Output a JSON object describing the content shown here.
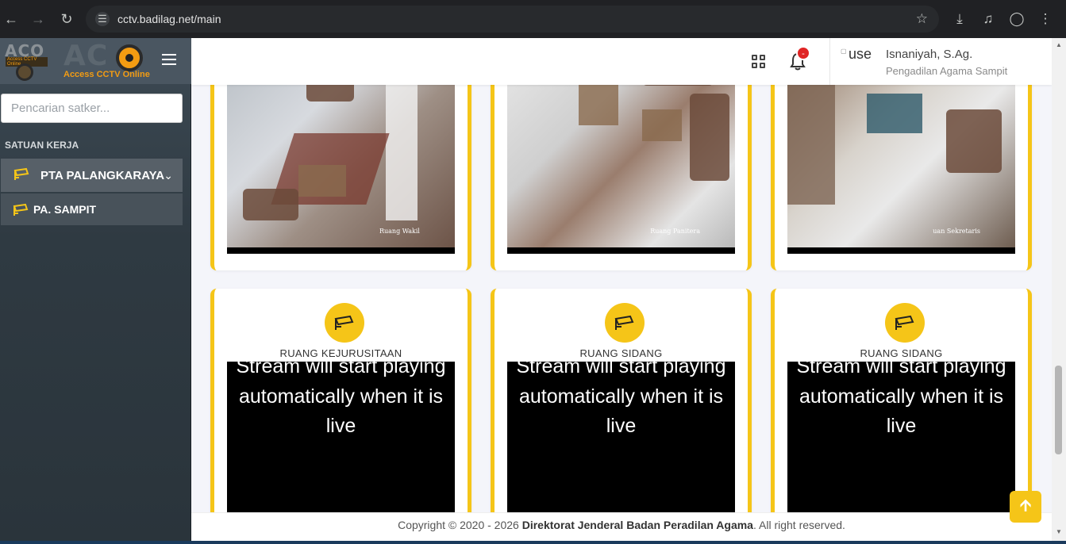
{
  "browser": {
    "url": "cctv.badilag.net/main"
  },
  "sidebar": {
    "logo_small_text": "ACO",
    "logo_small_tag": "Access CCTV Online",
    "logo_big_text": "AC",
    "logo_big_sub": "Access CCTV Online",
    "search_placeholder": "Pencarian satker...",
    "section_label": "SATUAN KERJA",
    "items": [
      {
        "label": "PTA PALANGKARAYA",
        "icon": "cctv-camera-icon",
        "expanded": true
      },
      {
        "label": "PA. SAMPIT",
        "icon": "cctv-camera-icon"
      }
    ]
  },
  "header": {
    "notification_badge": "-",
    "user_name": "Isnaniyah, S.Ag.",
    "user_org": "Pengadilan Agama Sampit",
    "avatar_alt": "use"
  },
  "cameras_top": [
    {
      "overlay_label": "Ruang Wakil"
    },
    {
      "overlay_label": "Ruang Panitera"
    },
    {
      "overlay_label": "uan Sekretaris"
    }
  ],
  "cameras_bottom": [
    {
      "name": "RUANG KEJURUSITAAN",
      "stream_text": "Stream will start playing automatically when it is live"
    },
    {
      "name": "RUANG SIDANG",
      "stream_text": "Stream will start playing automatically when it is live"
    },
    {
      "name": "RUANG SIDANG",
      "stream_text": "Stream will start playing automatically when it is live"
    }
  ],
  "footer": {
    "prefix": "Copyright © 2020 - 2026 ",
    "org": "Direktorat Jenderal Badan Peradilan Agama",
    "suffix": ". All right reserved."
  },
  "colors": {
    "accent": "#f5c518",
    "sidebar_bg": "#2f3a42",
    "badge": "#e02424"
  }
}
